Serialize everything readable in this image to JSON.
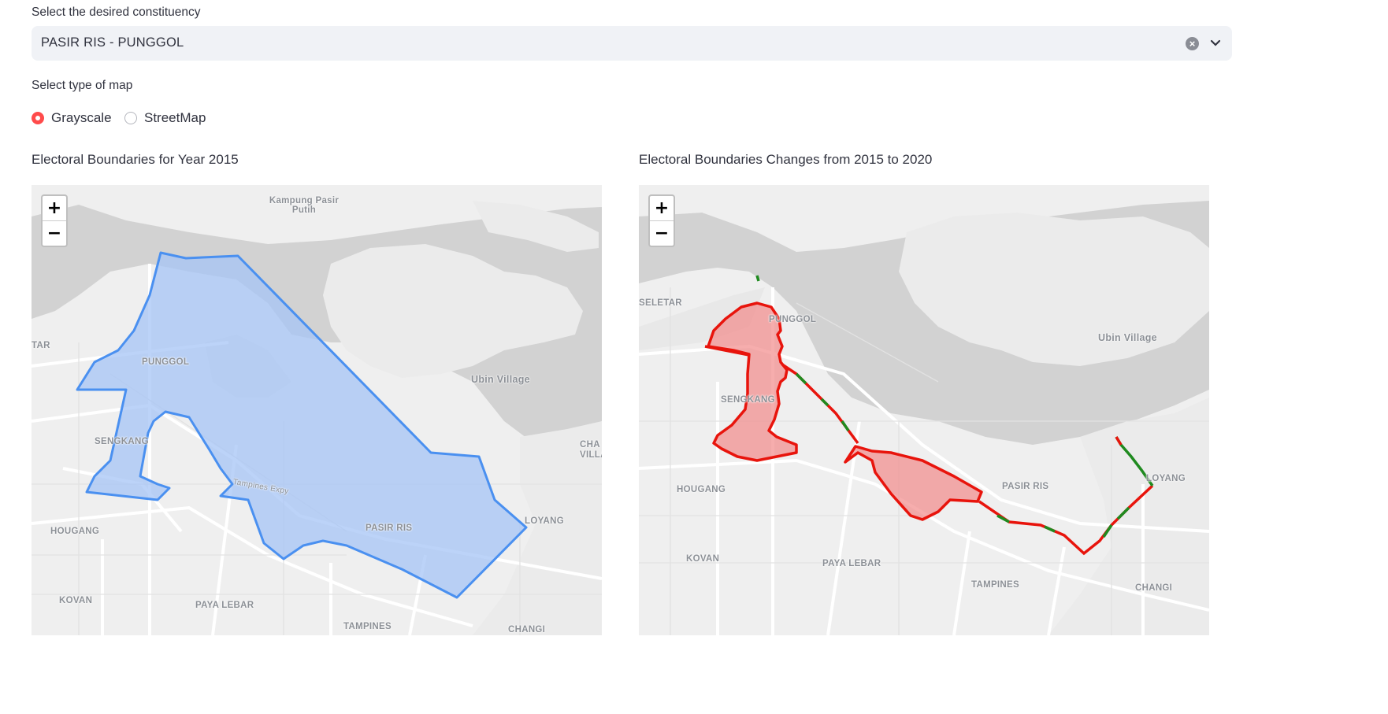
{
  "constituency": {
    "label": "Select the desired constituency",
    "selected": "PASIR RIS - PUNGGOL"
  },
  "map_type": {
    "label": "Select type of map",
    "options": [
      "Grayscale",
      "StreetMap"
    ],
    "selected": "Grayscale"
  },
  "left_map": {
    "heading": "Electoral Boundaries for Year 2015",
    "zoom_in": "+",
    "zoom_out": "−",
    "places": {
      "kampung": "Kampung Pasir Putih",
      "tar": "TAR",
      "punggol": "PUNGGOL",
      "ubin": "Ubin Village",
      "sengkang": "SENGKANG",
      "cha": "CHA",
      "villa": "VILLA",
      "loyang": "LOYANG",
      "pasirris": "PASIR RIS",
      "hougang": "HOUGANG",
      "kovan": "KOVAN",
      "payalebar": "PAYA LEBAR",
      "tampines": "TAMPINES",
      "changi": "CHANGI",
      "expy": "Tampines Expy"
    },
    "boundary_color": "#4a90f0",
    "fill_color": "#a6c4f5"
  },
  "right_map": {
    "heading": "Electoral Boundaries Changes from 2015 to 2020",
    "zoom_in": "+",
    "zoom_out": "−",
    "places": {
      "seletar": "SELETAR",
      "punggol": "PUNGGOL",
      "ubin": "Ubin Village",
      "sengkang": "SENGKANG",
      "pasirris": "PASIR RIS",
      "loyang": "LOYANG",
      "hougang": "HOUGANG",
      "kovan": "KOVAN",
      "payalebar": "PAYA LEBAR",
      "tampines": "TAMPINES",
      "changi": "CHANGI"
    },
    "removed_color": "#e8140c",
    "added_color": "#1f8a1f"
  }
}
